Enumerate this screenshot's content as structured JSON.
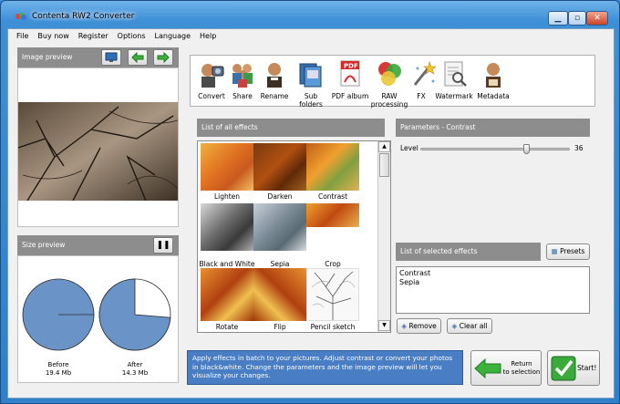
{
  "window": {
    "title": "Contenta RW2 Converter"
  },
  "menu": [
    "File",
    "Buy now",
    "Register",
    "Options",
    "Language",
    "Help"
  ],
  "image_preview": {
    "title": "Image preview"
  },
  "size_preview": {
    "title": "Size preview",
    "before": {
      "label": "Before",
      "size": "19.4 Mb",
      "fraction": 1.0
    },
    "after": {
      "label": "After",
      "size": "14.3 Mb",
      "fraction": 0.737
    }
  },
  "toolbar": [
    {
      "label": "Convert",
      "icon": "convert-icon"
    },
    {
      "label": "Share",
      "icon": "share-icon"
    },
    {
      "label": "Rename",
      "icon": "rename-icon"
    },
    {
      "label": "Sub folders",
      "icon": "subfolders-icon"
    },
    {
      "label": "PDF album",
      "icon": "pdf-icon"
    },
    {
      "label": "RAW",
      "label2": "processing",
      "icon": "raw-icon"
    },
    {
      "label": "FX",
      "icon": "fx-icon"
    },
    {
      "label": "Watermark",
      "icon": "watermark-icon"
    },
    {
      "label": "Metadata",
      "icon": "metadata-icon"
    }
  ],
  "effects": {
    "title": "List of all effects",
    "items": [
      "Lighten",
      "Darken",
      "Contrast",
      "Black and White",
      "Sepia",
      "Crop",
      "Rotate",
      "Flip",
      "Pencil sketch"
    ]
  },
  "parameters": {
    "title": "Parameters - Contrast",
    "level_label": "Level",
    "level_value": "36"
  },
  "selected": {
    "title": "List of selected effects",
    "presets": "Presets",
    "items": [
      "Contrast",
      "Sepia"
    ],
    "remove": "Remove",
    "clear": "Clear all"
  },
  "info": "Apply effects in batch to your pictures. Adjust contrast or convert your photos in black&white. Change the parameters and the image preview will let you visualize your changes.",
  "return_button": {
    "line1": "Return",
    "line2": "to selection"
  },
  "start_button": "Start!",
  "colors": {
    "pie": "#6a93c8",
    "panel_header": "#8d8d8d",
    "info_bg": "#4a7ec4"
  }
}
